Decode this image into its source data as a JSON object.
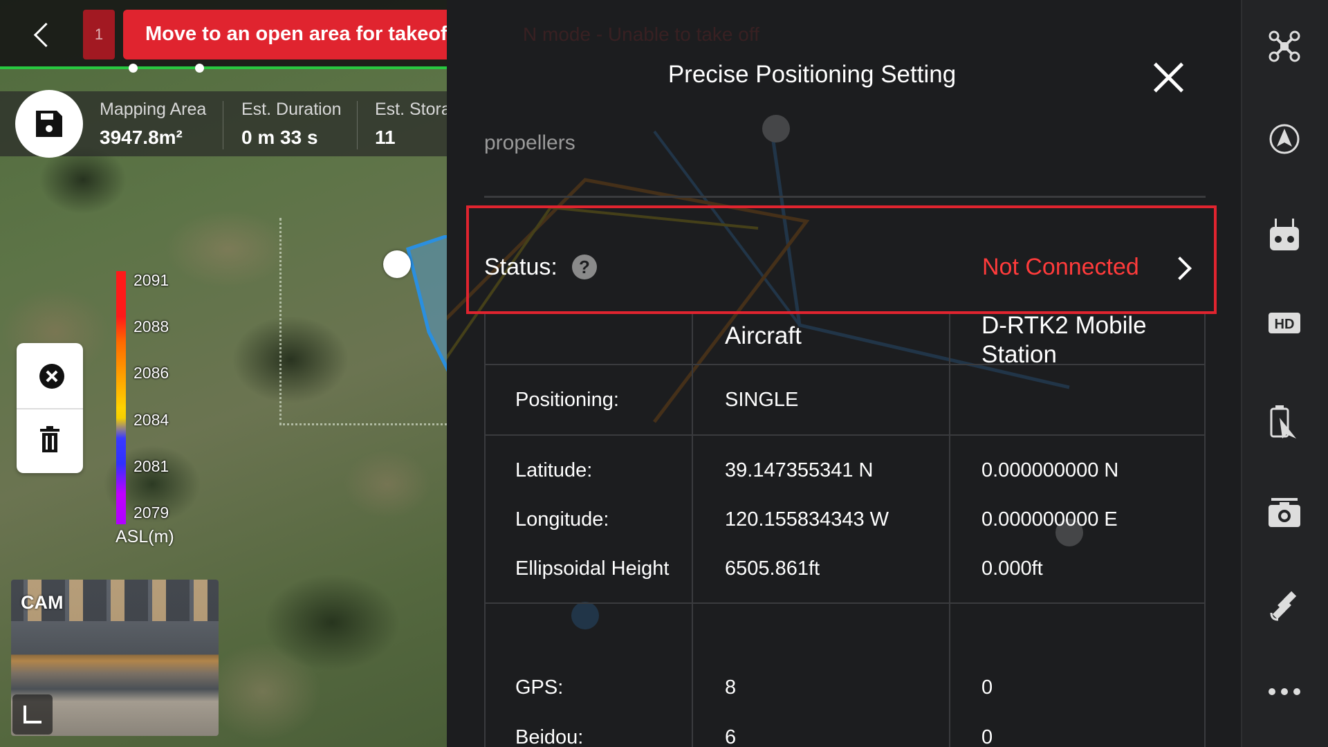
{
  "topbar": {
    "alert_count": "1",
    "alert_message": "Move to an open area for takeoff or"
  },
  "mission_stats": [
    {
      "label": "Mapping Area",
      "value": "3947.8m²"
    },
    {
      "label": "Est. Duration",
      "value": "0 m 33 s"
    },
    {
      "label": "Est. Storage",
      "value": "11"
    }
  ],
  "elevation_legend": {
    "ticks": [
      "2091",
      "2088",
      "2086",
      "2084",
      "2081",
      "2079"
    ],
    "unit": "ASL(m)"
  },
  "camera": {
    "label": "CAM"
  },
  "panel": {
    "title": "Precise Positioning Setting",
    "partial_text": "propellers",
    "status_label": "Status:",
    "help_glyph": "?",
    "status_value": "Not Connected",
    "status_color": "#ff3b3b"
  },
  "table": {
    "headers": [
      "Aircraft",
      "D-RTK2 Mobile Station"
    ],
    "rows": [
      {
        "label": "Positioning:",
        "aircraft": "SINGLE",
        "station": ""
      },
      {
        "label": "Latitude:",
        "aircraft": "39.147355341 N",
        "station": "0.000000000 N"
      },
      {
        "label": "Longitude:",
        "aircraft": "120.155834343 W",
        "station": "0.000000000 E"
      },
      {
        "label": "Ellipsoidal Height",
        "aircraft": "6505.861ft",
        "station": "0.000ft"
      },
      {
        "label": "GPS:",
        "aircraft": "8",
        "station": "0"
      },
      {
        "label": "Beidou:",
        "aircraft": "6",
        "station": "0"
      }
    ]
  },
  "sidebar": {
    "buttons": [
      {
        "icon": "aircraft-icon"
      },
      {
        "icon": "flight-mode-icon"
      },
      {
        "icon": "remote-controller-icon"
      },
      {
        "icon": "hd-icon",
        "text": "HD"
      },
      {
        "icon": "battery-icon"
      },
      {
        "icon": "camera-icon"
      },
      {
        "icon": "satellite-icon"
      },
      {
        "icon": "more-icon"
      }
    ]
  },
  "colors": {
    "alert_red": "#e0242f",
    "progress_green": "#28c840",
    "panel_bg": "#1c1d1f"
  }
}
